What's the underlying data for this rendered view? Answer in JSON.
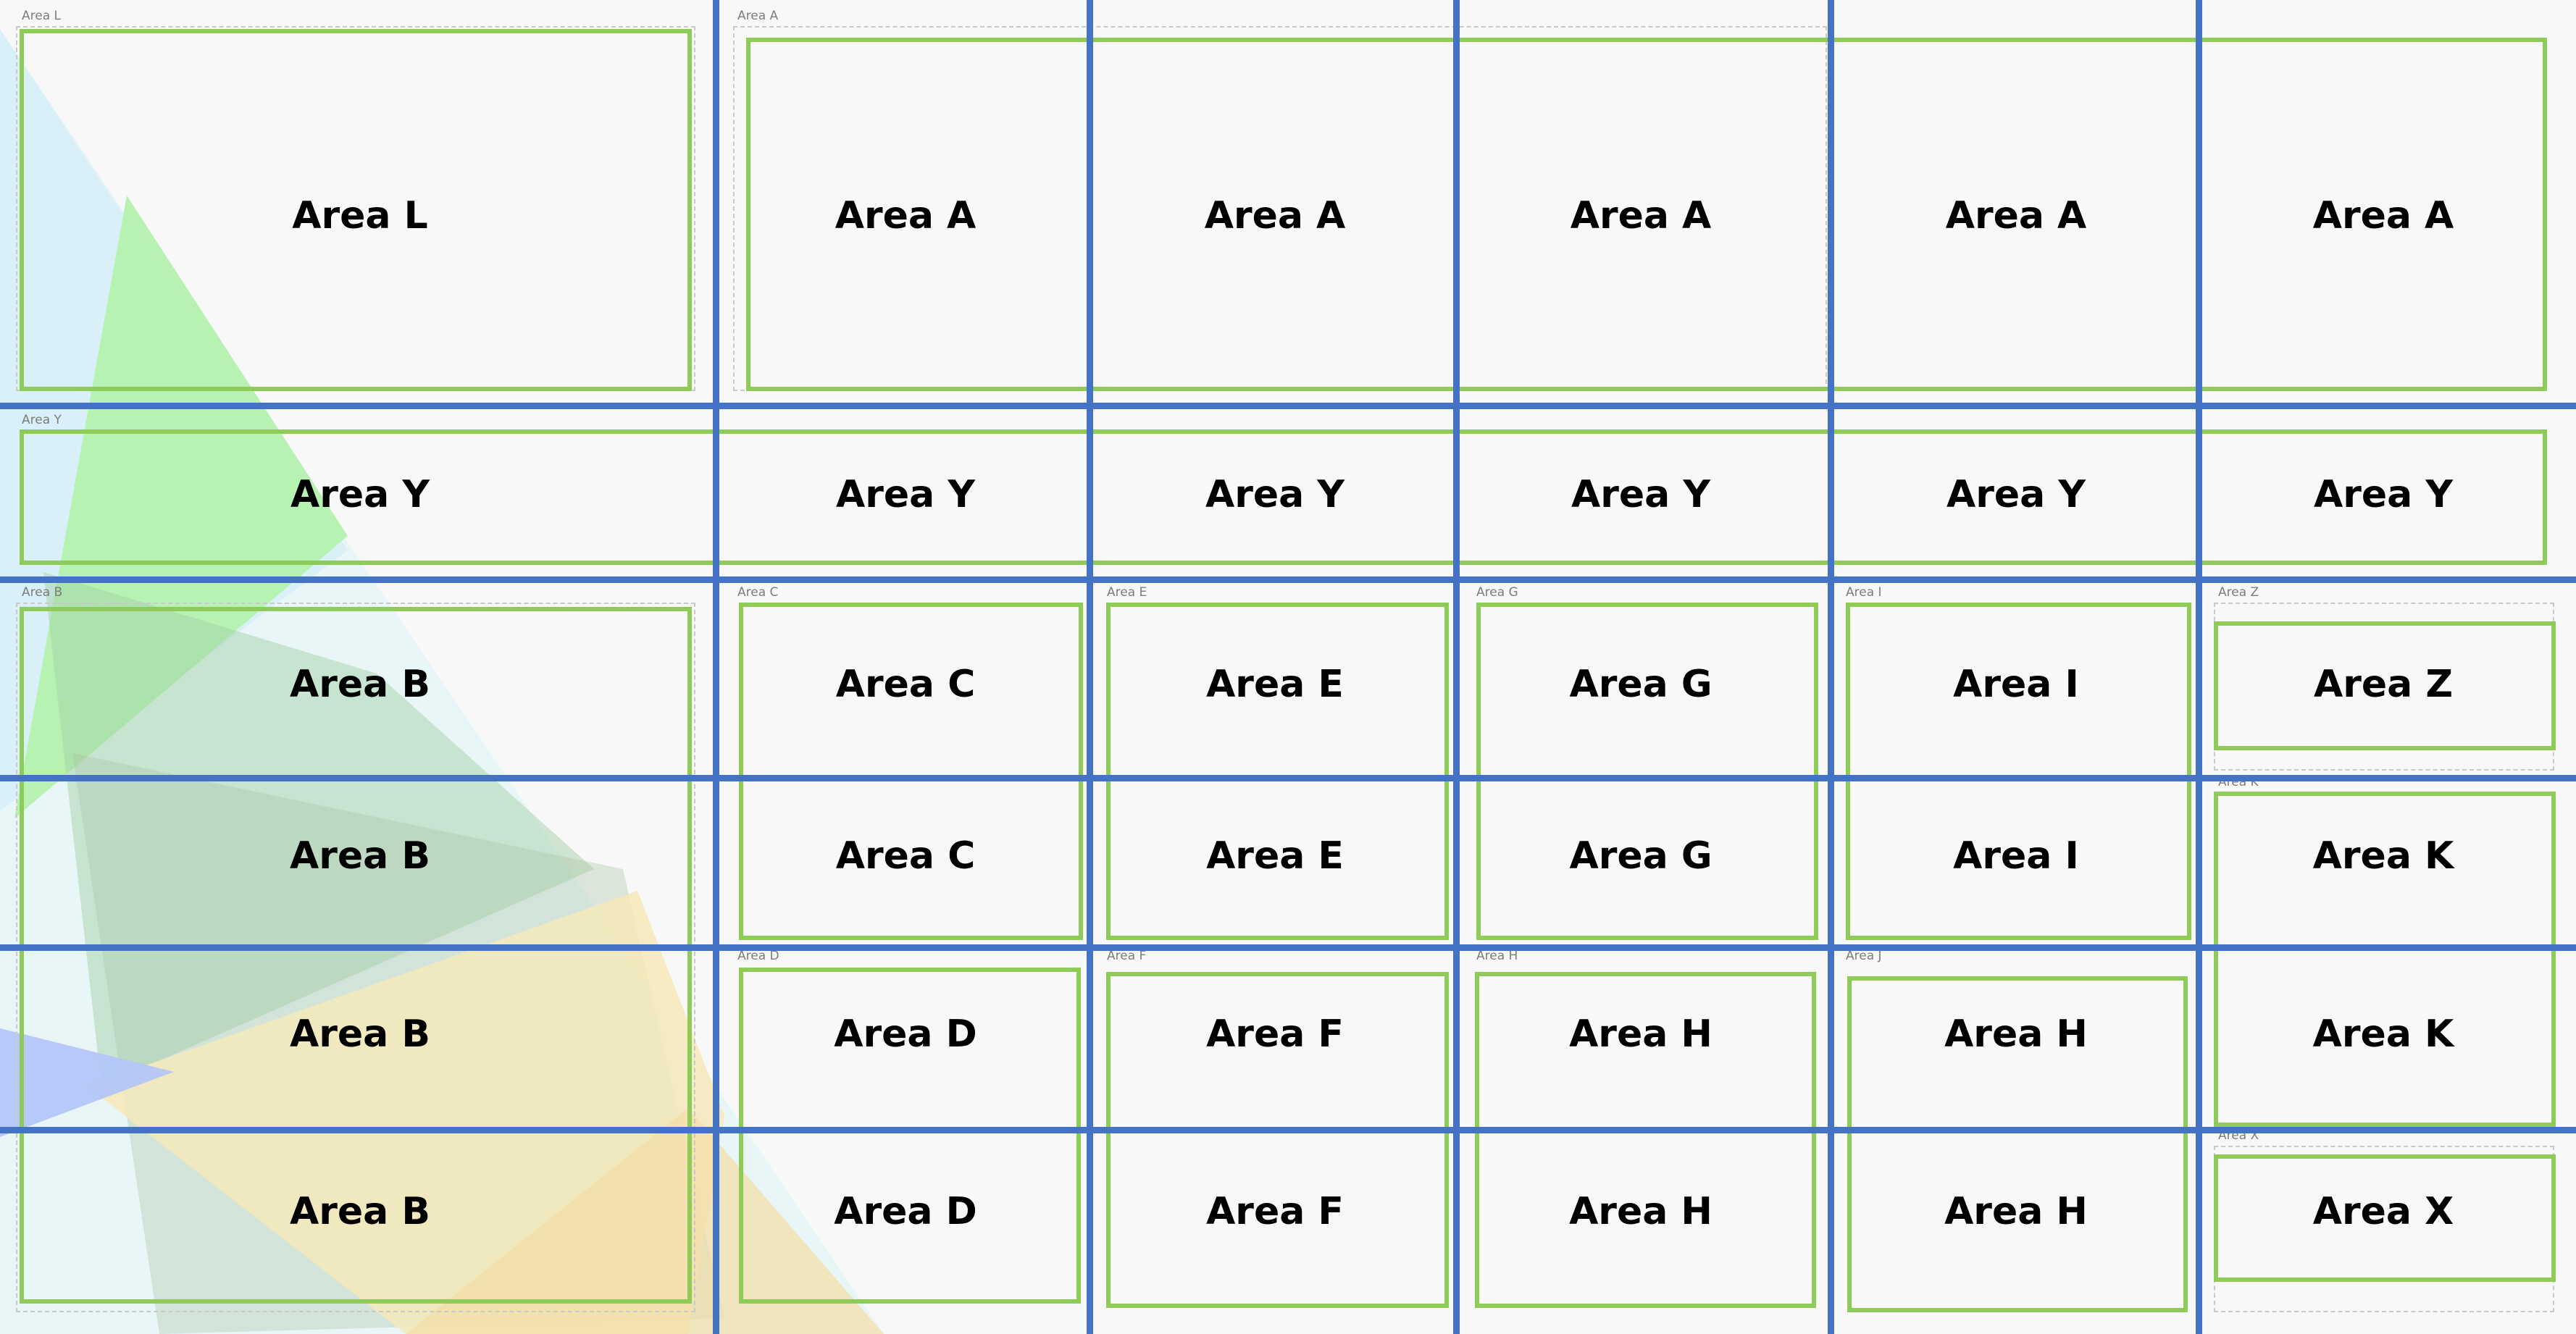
{
  "colors": {
    "background": "#f8f8f8",
    "grid_line": "#4472c4",
    "area_border": "#8ecb58",
    "dashed_border": "#c9c9c9"
  },
  "tags": {
    "L": "Area L",
    "A": "Area A",
    "Y": "Area Y",
    "B": "Area B",
    "C": "Area C",
    "E": "Area E",
    "G": "Area G",
    "I": "Area I",
    "Z": "Area Z",
    "K": "Area K",
    "D": "Area D",
    "F": "Area F",
    "H": "Area H",
    "J": "Area J",
    "X": "Area X"
  },
  "cells": [
    [
      "Area L",
      "Area A",
      "Area A",
      "Area A",
      "Area A",
      "Area A"
    ],
    [
      "Area Y",
      "Area Y",
      "Area Y",
      "Area Y",
      "Area Y",
      "Area Y"
    ],
    [
      "Area B",
      "Area C",
      "Area E",
      "Area G",
      "Area I",
      "Area Z"
    ],
    [
      "Area B",
      "Area C",
      "Area E",
      "Area G",
      "Area I",
      "Area K"
    ],
    [
      "Area B",
      "Area D",
      "Area F",
      "Area H",
      "Area H",
      "Area K"
    ],
    [
      "Area B",
      "Area D",
      "Area F",
      "Area H",
      "Area H",
      "Area X"
    ]
  ]
}
